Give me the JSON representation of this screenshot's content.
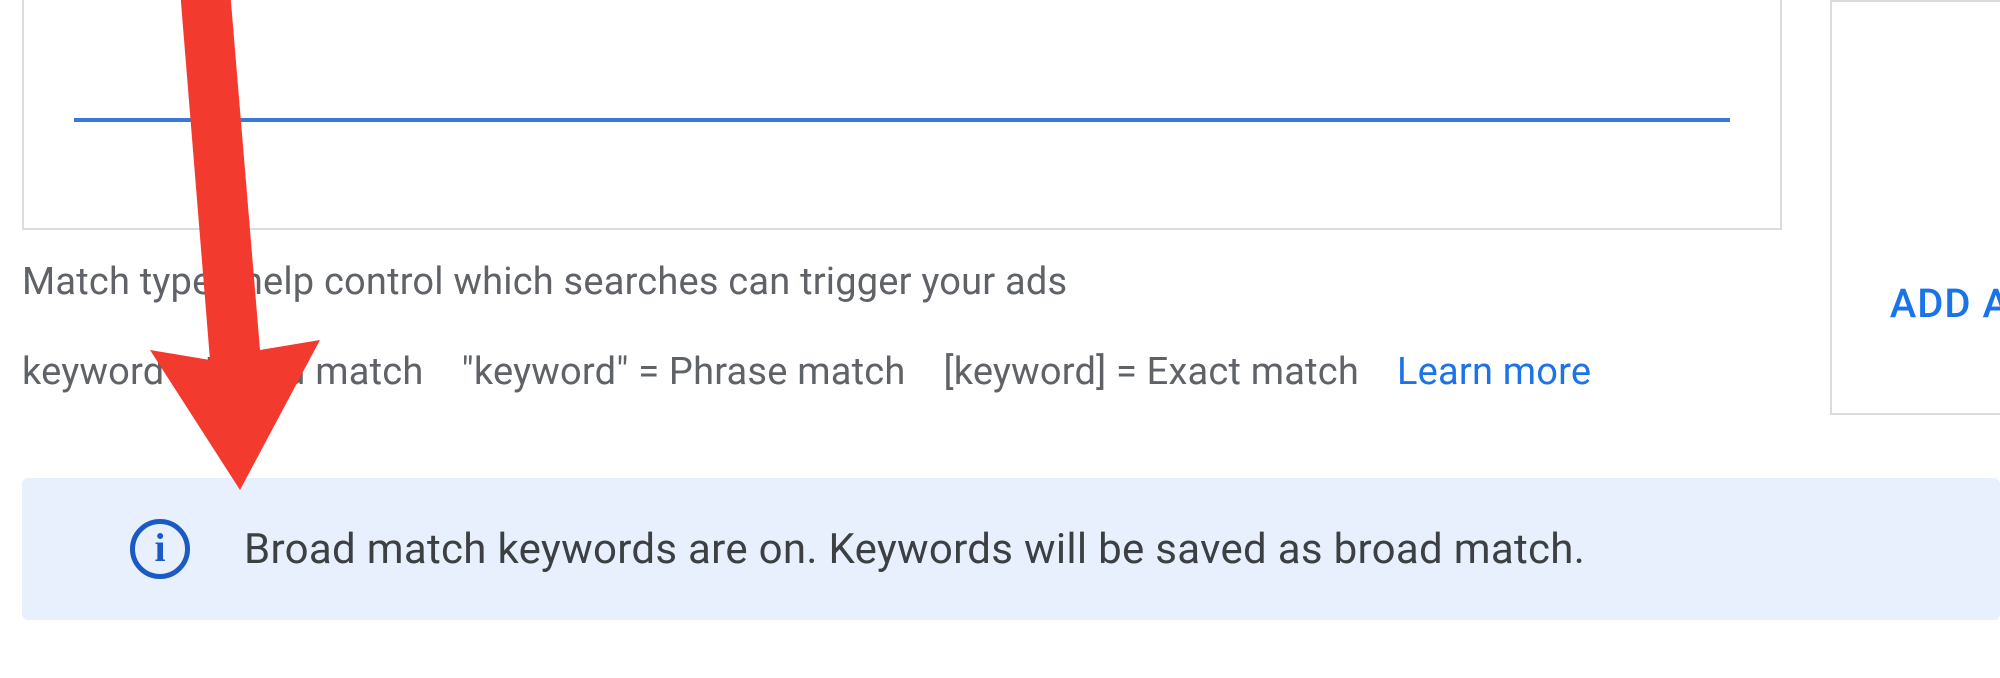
{
  "helper": {
    "line1": "Match types help control which searches can trigger your ads",
    "broad": "keyword = Broad match",
    "phrase": "\"keyword\" = Phrase match",
    "exact": "[keyword] = Exact match",
    "learn_more": "Learn more"
  },
  "side": {
    "add_label": "ADD A"
  },
  "banner": {
    "text": "Broad match keywords are on. Keywords will be saved as broad match."
  }
}
